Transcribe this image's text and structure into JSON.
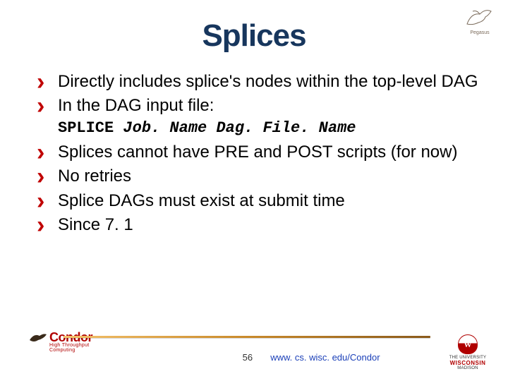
{
  "title": "Splices",
  "logos": {
    "pegasus_label": "Pegasus",
    "condor_name": "ondor",
    "condor_sub": "High Throughput Computing",
    "uw_top": "THE UNIVERSITY",
    "uw_name": "WISCONSIN",
    "uw_bottom": "MADISON"
  },
  "bullets": {
    "b1": "Directly includes splice's nodes within the top-level DAG",
    "b2": "In the DAG input file:",
    "code_kw": "SPLICE",
    "code_args": "Job. Name Dag. File. Name",
    "b3": "Splices cannot have PRE and POST scripts (for now)",
    "b4": "No retries",
    "b5": "Splice DAGs must exist at submit time",
    "b6": "Since 7. 1"
  },
  "footer": {
    "slide_number": "56",
    "url": "www. cs. wisc. edu/Condor"
  }
}
